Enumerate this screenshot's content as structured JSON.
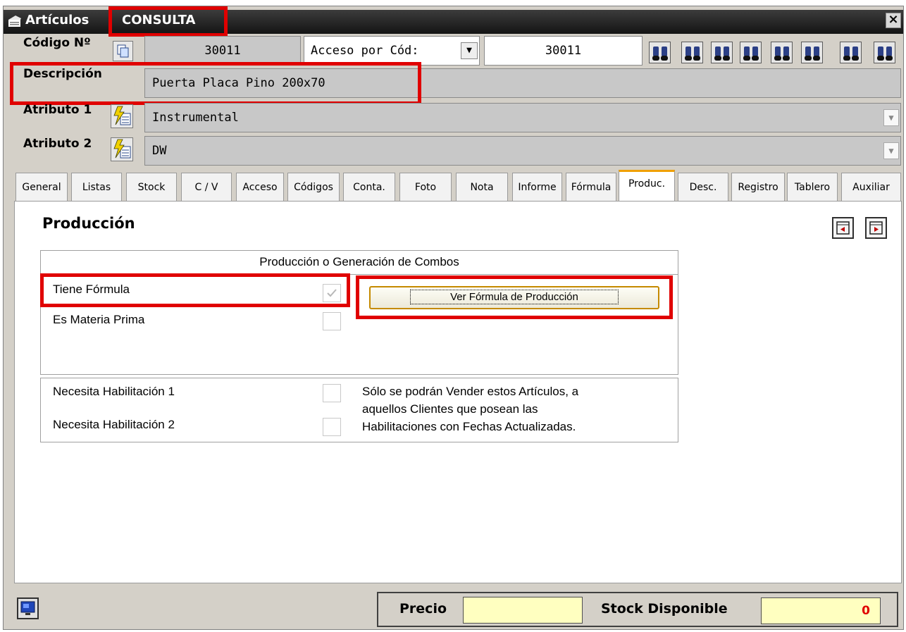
{
  "window": {
    "title": "Artículos",
    "mode": "CONSULTA",
    "close_label": "×"
  },
  "header": {
    "codigo_label": "Código Nº",
    "codigo_value": "30011",
    "acceso_select": "Acceso por Cód:",
    "acceso_value": "30011",
    "search_buttons_count": 8,
    "descripcion_label": "Descripción",
    "descripcion_value": "Puerta Placa Pino 200x70",
    "atributo1_label": "Atributo 1",
    "atributo1_value": "Instrumental",
    "atributo2_label": "Atributo 2",
    "atributo2_value": "DW"
  },
  "tabs": [
    {
      "label": "General"
    },
    {
      "label": "Listas"
    },
    {
      "label": "Stock"
    },
    {
      "label": "C / V"
    },
    {
      "label": "Acceso"
    },
    {
      "label": "Códigos"
    },
    {
      "label": "Conta."
    },
    {
      "label": "Foto"
    },
    {
      "label": "Nota"
    },
    {
      "label": "Informe"
    },
    {
      "label": "Fórmula"
    },
    {
      "label": "Produc.",
      "active": true
    },
    {
      "label": "Desc."
    },
    {
      "label": "Registro"
    },
    {
      "label": "Tablero"
    },
    {
      "label": "Auxiliar"
    }
  ],
  "produccion": {
    "section_title": "Producción",
    "group_title": "Producción o Generación de Combos",
    "tiene_formula_label": "Tiene Fórmula",
    "tiene_formula_checked": true,
    "es_materia_prima_label": "Es Materia Prima",
    "es_materia_prima_checked": false,
    "ver_formula_button": "Ver Fórmula de Producción",
    "habilitacion1_label": "Necesita Habilitación 1",
    "habilitacion2_label": "Necesita Habilitación 2",
    "habilitacion_note_1": "Sólo se podrán Vender estos Artículos, a",
    "habilitacion_note_2": "aquellos Clientes que posean las",
    "habilitacion_note_3": "Habilitaciones con Fechas Actualizadas."
  },
  "footer": {
    "precio_label": "Precio",
    "precio_value": "",
    "stock_label": "Stock Disponible",
    "stock_value": "0"
  },
  "colors": {
    "highlight": "#e00000",
    "active_tab_accent": "#f0a000",
    "field_yellow": "#ffffc0",
    "stock_value_color": "#e00000"
  }
}
